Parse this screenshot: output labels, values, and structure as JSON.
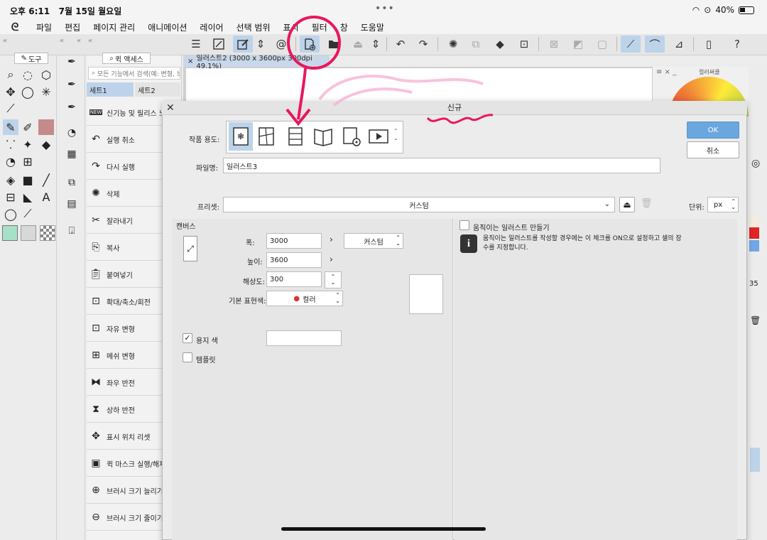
{
  "status": {
    "time": "오후 6:11",
    "date": "7월 15일 월요일",
    "dots": "•••",
    "battery": "40%"
  },
  "menu": [
    "파일",
    "편집",
    "페이지 관리",
    "애니메이션",
    "레이어",
    "선택 범위",
    "표시",
    "필터",
    "창",
    "도움말"
  ],
  "tool_panel": {
    "tab": "도구"
  },
  "quick_access": {
    "tab": "퀵 액세스",
    "search_placeholder": "모든 기능에서 검색(예: 변형, 브",
    "set1": "세트1",
    "set2": "세트2",
    "items": [
      "신기능 및 릴리스 노트 시",
      "실행 취소",
      "다시 실행",
      "삭제",
      "잘라내기",
      "복사",
      "붙여넣기",
      "확대/축소/회전",
      "자유 변형",
      "메쉬 변형",
      "좌우 반전",
      "상하 반전",
      "표시 위치 리셋",
      "퀵 마스크 실행/해제",
      "브러시 크기 늘리기",
      "브러시 크기 줄이기"
    ]
  },
  "document_tab": "일러스트2 (3000 x 3600px 300dpi 49.1%)",
  "right_panel": {
    "title": "컬러써클",
    "value_fragment": "35"
  },
  "dialog": {
    "title": "신규",
    "usage_label": "작품 용도:",
    "ok": "OK",
    "cancel": "취소",
    "filename_label": "파일명:",
    "filename_value": "일러스트3",
    "preset_label": "프리셋:",
    "preset_value": "커스텀",
    "unit_label": "단위:",
    "unit_value": "px",
    "canvas_group": "캔버스",
    "width_label": "폭:",
    "width_value": "3000",
    "height_label": "높이:",
    "height_value": "3600",
    "size_preset": "커스텀",
    "resolution_label": "해상도:",
    "resolution_value": "300",
    "color_mode_label": "기본 표현색:",
    "color_mode_value": "컬러",
    "paper_color_label": "용지 색",
    "paper_color_checked": true,
    "template_label": "템플릿",
    "template_checked": false,
    "anim_checkbox_label": "움직이는 일러스트 만들기",
    "anim_info": "움직이는 일러스트를 작성할 경우에는 이 체크를 ON으로 설정하고 셀의 장수를 지정합니다."
  },
  "colors": {
    "accent": "#6aa7de",
    "selection": "#bcd3ea",
    "annotation": "#e8175d"
  }
}
